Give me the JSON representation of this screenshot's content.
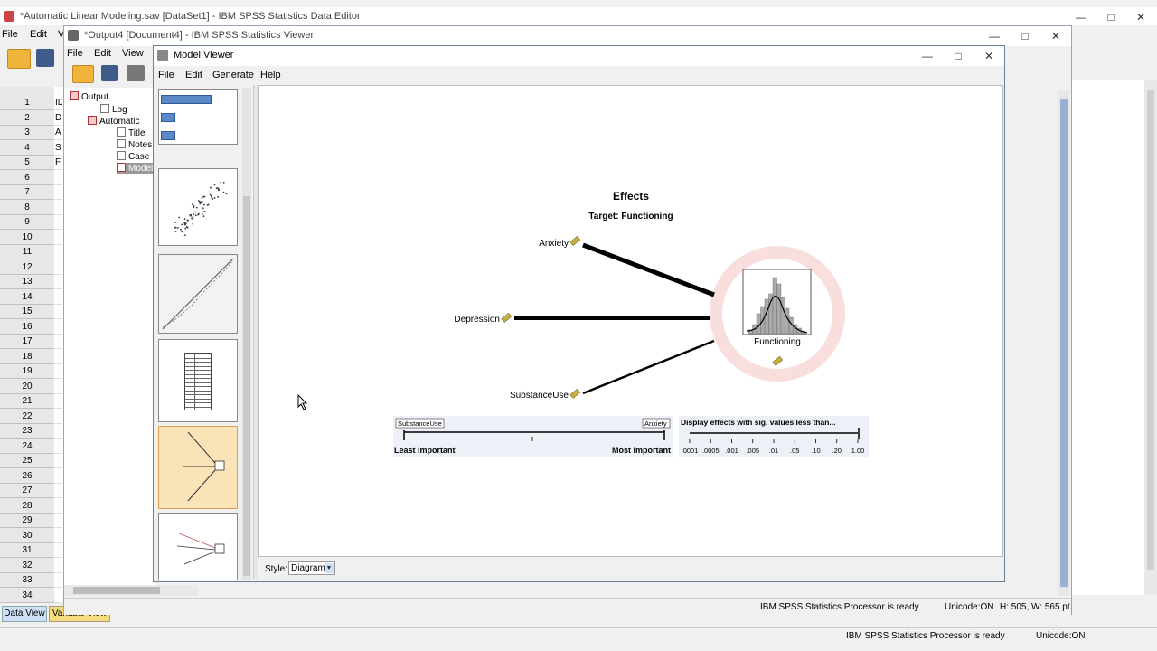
{
  "data_editor": {
    "title": "*Automatic Linear Modeling.sav [DataSet1] - IBM SPSS Statistics Data Editor",
    "menu": [
      "File",
      "Edit",
      "V"
    ],
    "row_numbers": [
      "1",
      "2",
      "3",
      "4",
      "5",
      "6",
      "7",
      "8",
      "9",
      "10",
      "11",
      "12",
      "13",
      "14",
      "15",
      "16",
      "17",
      "18",
      "19",
      "20",
      "21",
      "22",
      "23",
      "24",
      "25",
      "26",
      "27",
      "28",
      "29",
      "30",
      "31",
      "32",
      "33",
      "34"
    ],
    "cells": [
      "ID",
      "D",
      "A",
      "S",
      "F"
    ],
    "tabs": {
      "data_view": "Data View",
      "variable_view": "Variable View"
    },
    "status": {
      "processor": "IBM SPSS Statistics Processor is ready",
      "unicode": "Unicode:ON"
    }
  },
  "viewer": {
    "title": "*Output4 [Document4] - IBM SPSS Statistics Viewer",
    "menu": [
      "File",
      "Edit",
      "View"
    ],
    "tree": [
      {
        "label": "Output"
      },
      {
        "label": "Log"
      },
      {
        "label": "Automatic"
      },
      {
        "label": "Title"
      },
      {
        "label": "Notes"
      },
      {
        "label": "Case"
      },
      {
        "label": "Model"
      }
    ],
    "status": {
      "processor": "IBM SPSS Statistics Processor is ready",
      "unicode": "Unicode:ON",
      "size": "H: 505, W: 565 pt."
    }
  },
  "model_viewer": {
    "title": "Model Viewer",
    "menu": [
      "File",
      "Edit",
      "Generate",
      "Help"
    ],
    "style_label": "Style:",
    "style_value": "Diagram",
    "diagram": {
      "title": "Effects",
      "subtitle": "Target: Functioning",
      "predictors": [
        "Anxiety",
        "Depression",
        "SubstanceUse"
      ],
      "target": "Functioning",
      "importance_slider": {
        "left_tag": "SubstanceUse",
        "right_tag": "Anxiety",
        "least": "Least Important",
        "most": "Most Important"
      },
      "sig_slider": {
        "label": "Display effects with sig. values less than...",
        "ticks": [
          ".0001",
          ".0005",
          ".001",
          ".005",
          ".01",
          ".05",
          ".10",
          ".20",
          "1.00"
        ]
      }
    }
  },
  "colors": {
    "accent": "#4a7ebf",
    "selected_thumb": "#fbe3b8",
    "highlight": "#f7d3d3"
  }
}
